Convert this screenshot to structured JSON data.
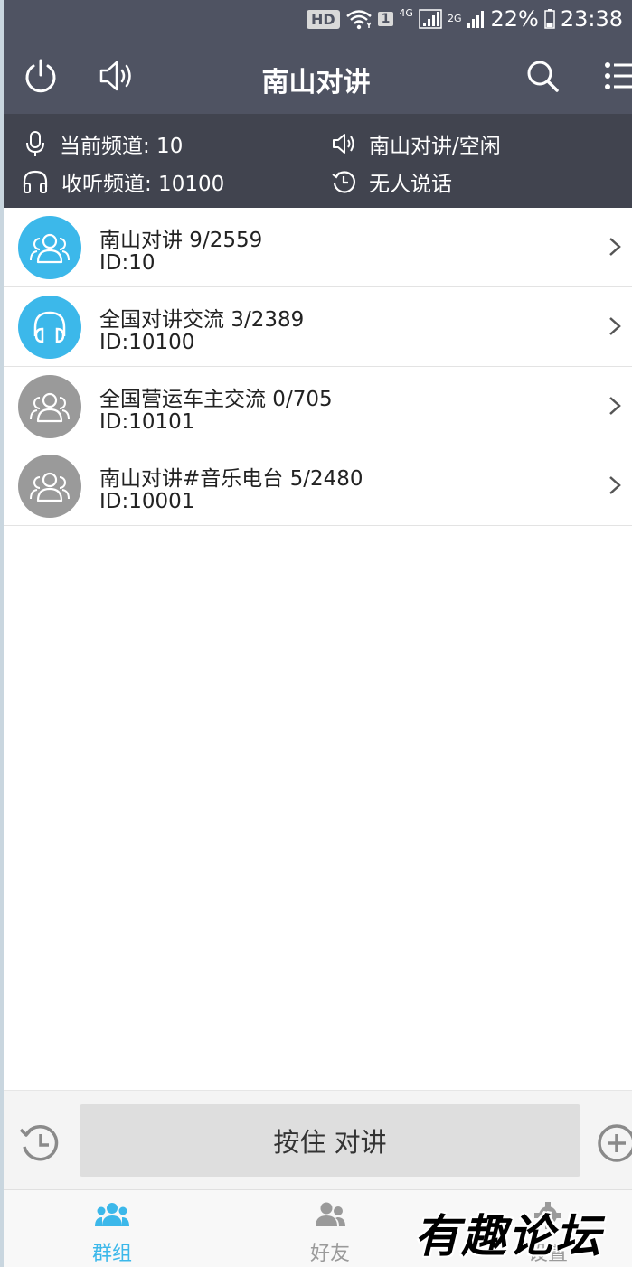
{
  "status_bar": {
    "hd": "HD",
    "sim": "1",
    "network_4g": "4G",
    "network_2g": "2G",
    "battery": "22%",
    "time": "23:38"
  },
  "header": {
    "title": "南山对讲"
  },
  "info": {
    "current_channel": "当前频道: 10",
    "listen_channel": "收听频道: 10100",
    "channel_status": "南山对讲/空闲",
    "speaker_status": "无人说话"
  },
  "channels": [
    {
      "name": "南山对讲 9/2559",
      "id": "ID:10",
      "icon": "group-icon",
      "color": "#3cb8ea"
    },
    {
      "name": "全国对讲交流 3/2389",
      "id": "ID:10100",
      "icon": "headphones-icon",
      "color": "#3cb8ea"
    },
    {
      "name": "全国营运车主交流 0/705",
      "id": "ID:10101",
      "icon": "group-icon",
      "color": "#9a9a9a"
    },
    {
      "name": "南山对讲#音乐电台 5/2480",
      "id": "ID:10001",
      "icon": "group-icon",
      "color": "#9a9a9a"
    }
  ],
  "ptt": {
    "label": "按住 对讲"
  },
  "nav": {
    "groups": "群组",
    "friends": "好友",
    "settings": "设置",
    "active_color": "#3cb8ea",
    "inactive_color": "#9a9a9a"
  },
  "watermark": "有趣论坛"
}
